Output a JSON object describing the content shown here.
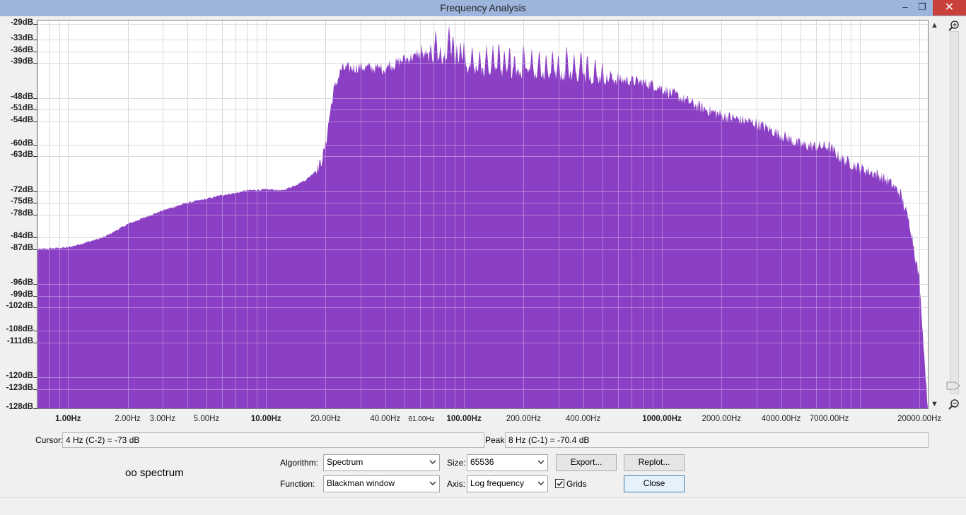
{
  "window": {
    "title": "Frequency Analysis",
    "buttons": {
      "minimize": "–",
      "maximize": "❐",
      "close": "✕"
    }
  },
  "colors": {
    "spectrum_fill": "#8a3fc4",
    "grid": "#c8c8c8",
    "background": "#ffffff"
  },
  "chart_data": {
    "type": "area",
    "xscale": "log",
    "xlim": [
      0.7,
      22050
    ],
    "ylim": [
      -128,
      -28
    ],
    "grid": true,
    "y_ticks": [
      {
        "value": -29,
        "label": "-29dB"
      },
      {
        "value": -33,
        "label": "-33dB"
      },
      {
        "value": -36,
        "label": "-36dB"
      },
      {
        "value": -39,
        "label": "-39dB"
      },
      {
        "value": -48,
        "label": "-48dB"
      },
      {
        "value": -51,
        "label": "-51dB"
      },
      {
        "value": -54,
        "label": "-54dB"
      },
      {
        "value": -60,
        "label": "-60dB"
      },
      {
        "value": -63,
        "label": "-63dB"
      },
      {
        "value": -72,
        "label": "-72dB"
      },
      {
        "value": -75,
        "label": "-75dB"
      },
      {
        "value": -78,
        "label": "-78dB"
      },
      {
        "value": -84,
        "label": "-84dB"
      },
      {
        "value": -87,
        "label": "-87dB"
      },
      {
        "value": -96,
        "label": "-96dB"
      },
      {
        "value": -99,
        "label": "-99dB"
      },
      {
        "value": -102,
        "label": "-102dB"
      },
      {
        "value": -108,
        "label": "-108dB"
      },
      {
        "value": -111,
        "label": "-111dB"
      },
      {
        "value": -120,
        "label": "-120dB"
      },
      {
        "value": -123,
        "label": "-123dB"
      },
      {
        "value": -128,
        "label": "-128dB"
      }
    ],
    "x_ticks": [
      {
        "value": 1,
        "label": "1.00Hz",
        "major": true
      },
      {
        "value": 2,
        "label": "2.00Hz"
      },
      {
        "value": 3,
        "label": "3.00Hz"
      },
      {
        "value": 5,
        "label": "5.00Hz"
      },
      {
        "value": 10,
        "label": "10.00Hz",
        "major": true
      },
      {
        "value": 20,
        "label": "20.00Hz"
      },
      {
        "value": 40,
        "label": "40.00Hz"
      },
      {
        "value": 61,
        "label": "61.00Hz",
        "minor": true
      },
      {
        "value": 100,
        "label": "100.00Hz",
        "major": true
      },
      {
        "value": 200,
        "label": "200.00Hz"
      },
      {
        "value": 400,
        "label": "400.00Hz"
      },
      {
        "value": 1000,
        "label": "1000.00Hz",
        "major": true
      },
      {
        "value": 2000,
        "label": "2000.00Hz"
      },
      {
        "value": 4000,
        "label": "4000.00Hz"
      },
      {
        "value": 7000,
        "label": "7000.00Hz"
      },
      {
        "value": 20000,
        "label": "20000.00Hz"
      }
    ],
    "envelope": {
      "x": [
        0.7,
        1,
        1.5,
        2,
        3,
        4,
        5,
        6,
        7,
        8,
        10,
        11,
        12,
        14,
        16,
        18,
        19,
        20,
        21,
        22,
        24,
        30,
        40,
        50,
        61,
        80,
        100,
        120,
        160,
        200,
        300,
        400,
        500,
        700,
        900,
        1000,
        1500,
        2000,
        3000,
        4000,
        5000,
        6000,
        7000,
        8000,
        10000,
        12000,
        14000,
        16000,
        18000,
        20000,
        21000,
        22050
      ],
      "y": [
        -87,
        -86.5,
        -84,
        -80.5,
        -77,
        -75,
        -74,
        -73,
        -72.5,
        -71.8,
        -71.6,
        -71.6,
        -71.9,
        -70.5,
        -69,
        -66.5,
        -64.5,
        -60,
        -52,
        -46,
        -40.5,
        -40,
        -40.5,
        -38,
        -37,
        -38.5,
        -40.5,
        -41,
        -41.5,
        -41.5,
        -42,
        -42.5,
        -43,
        -43.5,
        -44.5,
        -45.5,
        -50,
        -52.5,
        -54.5,
        -57.5,
        -60,
        -60.5,
        -60.5,
        -63.5,
        -66,
        -67.5,
        -69.5,
        -72.5,
        -81,
        -95,
        -112,
        -128
      ]
    },
    "peaks": {
      "x": [
        33,
        38,
        42,
        46,
        50,
        54,
        58,
        61,
        64,
        68,
        72,
        76,
        80,
        84,
        88,
        92,
        96,
        100,
        110,
        120,
        130,
        140,
        150,
        160,
        170,
        180,
        200,
        220,
        240,
        260,
        280,
        300,
        330,
        360,
        390,
        420,
        460,
        500,
        550,
        600,
        650,
        700,
        800,
        900,
        1000,
        1100,
        1200,
        1300,
        1500,
        1700,
        1900,
        2100,
        2400,
        2700,
        3000,
        3300,
        3700,
        4000
      ],
      "y": [
        -40,
        -39,
        -37.5,
        -37,
        -37,
        -36,
        -35,
        -34,
        -35,
        -33.5,
        -30,
        -34,
        -36,
        -29,
        -31,
        -34,
        -33,
        -33,
        -34,
        -35,
        -34,
        -34,
        -33,
        -35,
        -34,
        -36,
        -33.5,
        -35,
        -35,
        -36,
        -35,
        -36,
        -34,
        -36,
        -35,
        -36,
        -37,
        -38,
        -40,
        -41,
        -42,
        -42,
        -43,
        -45,
        -47,
        -48,
        -50,
        -50,
        -52,
        -51,
        -52,
        -53,
        -54,
        -55,
        -56,
        -57,
        -58,
        -59
      ]
    }
  },
  "cursor": {
    "label": "Cursor:",
    "value": "4 Hz (C-2) = -73 dB"
  },
  "peak": {
    "label": "Peak:",
    "value": "8 Hz (C-1) = -70.4 dB"
  },
  "track_name": "oo spectrum",
  "controls": {
    "algorithm_label": "Algorithm:",
    "algorithm_value": "Spectrum",
    "size_label": "Size:",
    "size_value": "65536",
    "function_label": "Function:",
    "function_value": "Blackman window",
    "axis_label": "Axis:",
    "axis_value": "Log frequency",
    "export_label": "Export...",
    "replot_label": "Replot...",
    "grids_label": "Grids",
    "grids_checked": true,
    "close_label": "Close"
  },
  "icons": {
    "zoom_in": "zoom-in-icon",
    "zoom_out": "zoom-out-icon",
    "dropdown": "chevron-down-icon"
  }
}
